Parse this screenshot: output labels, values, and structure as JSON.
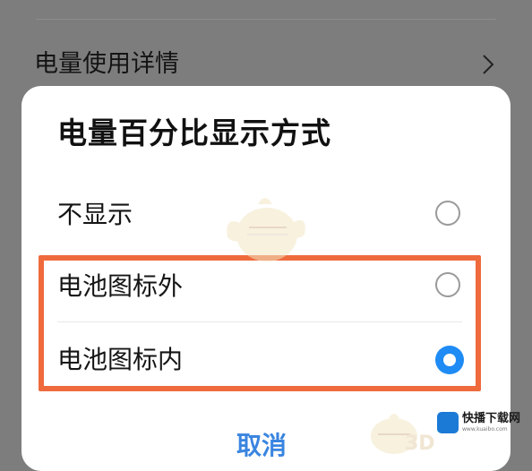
{
  "background": {
    "row_label": "电量使用详情",
    "chevron_icon": "chevron-right-icon"
  },
  "dialog": {
    "title": "电量百分比显示方式",
    "options": [
      {
        "label": "不显示",
        "selected": false
      },
      {
        "label": "电池图标外",
        "selected": false
      },
      {
        "label": "电池图标内",
        "selected": true
      }
    ],
    "cancel_label": "取消"
  },
  "highlight_color": "#ef6a3c",
  "accent_color": "#1f8bf5",
  "watermark": {
    "mascot_icon": "chick-mascot-icon",
    "text_3d": "3D",
    "site_logo": "快播下载网",
    "site_logo_sub": "www.kuaibo.com"
  }
}
